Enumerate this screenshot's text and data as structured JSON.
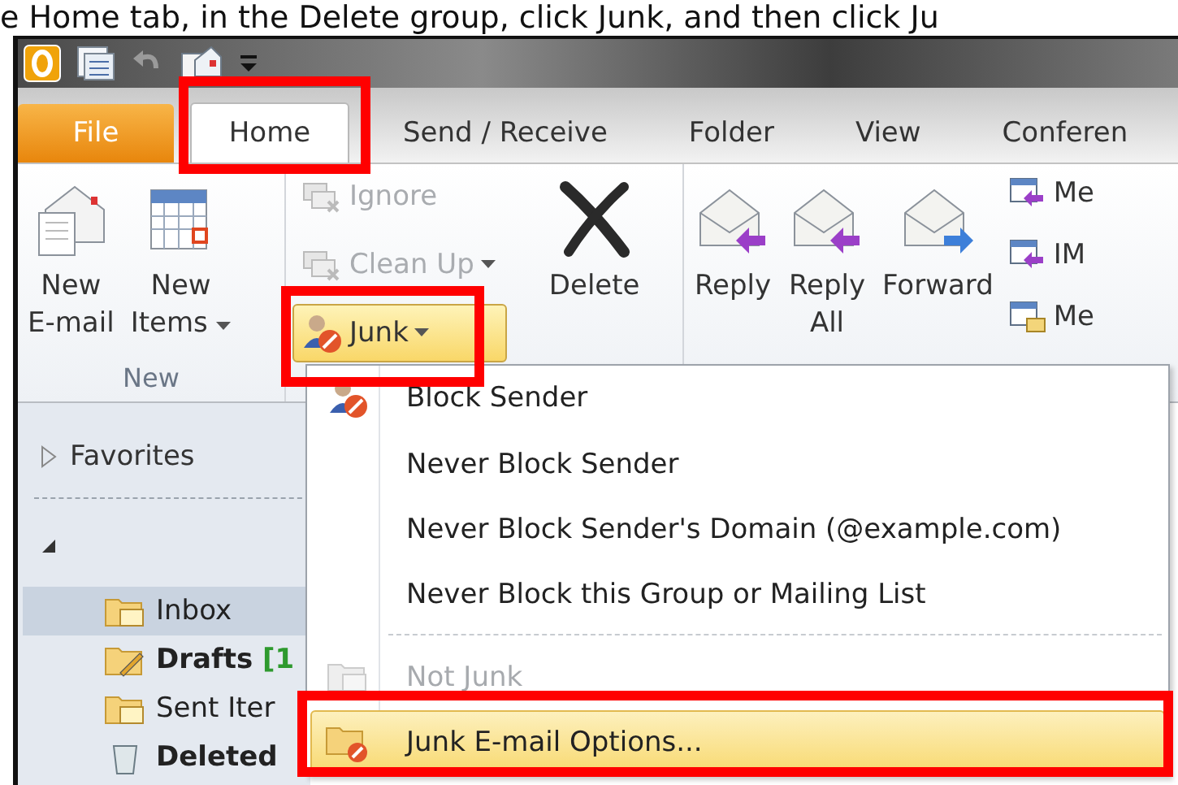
{
  "caption": "e Home tab, in the Delete group, click Junk, and then click Ju",
  "tabs": [
    {
      "label": "File",
      "kind": "file",
      "selected": false
    },
    {
      "label": "Home",
      "kind": "tab",
      "selected": true
    },
    {
      "label": "Send / Receive",
      "kind": "tab",
      "selected": false
    },
    {
      "label": "Folder",
      "kind": "tab",
      "selected": false
    },
    {
      "label": "View",
      "kind": "tab",
      "selected": false
    },
    {
      "label": "Conferen",
      "kind": "tab",
      "selected": false
    }
  ],
  "ribbon": {
    "new_group": {
      "label": "New",
      "buttons": [
        {
          "label": "New\nE-mail",
          "dropdown": false
        },
        {
          "label": "New\nItems",
          "dropdown": true
        }
      ]
    },
    "delete_group": {
      "small_buttons": [
        {
          "label": "Ignore",
          "disabled": true,
          "dropdown": false,
          "active": false
        },
        {
          "label": "Clean Up",
          "disabled": true,
          "dropdown": true,
          "active": false
        },
        {
          "label": "Junk",
          "disabled": false,
          "dropdown": true,
          "active": true
        }
      ],
      "big_button": "Delete"
    },
    "respond_group": {
      "buttons": [
        "Reply",
        "Reply\nAll",
        "Forward"
      ],
      "small_buttons": [
        "Me",
        "IM",
        "Me"
      ]
    }
  },
  "nav": {
    "favorites": "Favorites",
    "folders": [
      {
        "label": "Inbox",
        "bold": false,
        "selected": true
      },
      {
        "label": "Drafts",
        "bold": true,
        "count": "[1",
        "selected": false
      },
      {
        "label": "Sent Iter",
        "bold": false,
        "selected": false
      },
      {
        "label": "Deleted",
        "bold": true,
        "selected": false
      }
    ]
  },
  "junk_menu": [
    {
      "kind": "item",
      "label": "Block Sender",
      "disabled": false,
      "selected": false
    },
    {
      "kind": "item",
      "label": "Never Block Sender",
      "disabled": false,
      "selected": false
    },
    {
      "kind": "item",
      "label": "Never Block Sender's Domain (@example.com)",
      "disabled": false,
      "selected": false
    },
    {
      "kind": "item",
      "label": "Never Block this Group or Mailing List",
      "disabled": false,
      "selected": false
    },
    {
      "kind": "separator"
    },
    {
      "kind": "item",
      "label": "Not Junk",
      "disabled": true,
      "selected": false
    },
    {
      "kind": "item",
      "label": "Junk E-mail Options...",
      "disabled": false,
      "selected": true
    }
  ]
}
